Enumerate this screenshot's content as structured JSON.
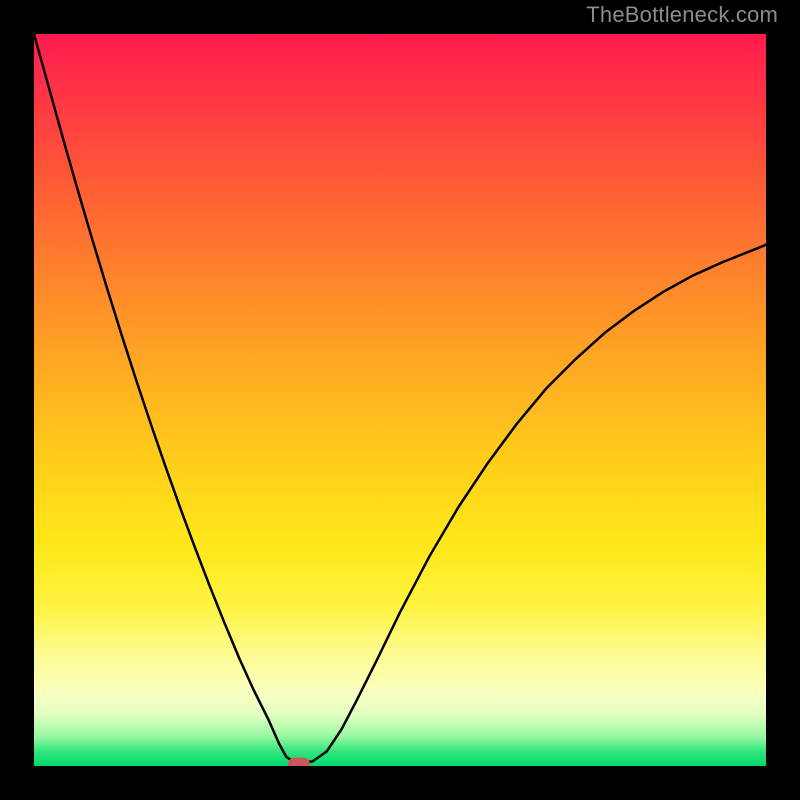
{
  "watermark": "TheBottleneck.com",
  "chart_data": {
    "type": "line",
    "title": "",
    "xlabel": "",
    "ylabel": "",
    "xlim": [
      0,
      1
    ],
    "ylim": [
      0,
      1
    ],
    "series": [
      {
        "name": "bottleneck-curve",
        "x": [
          0.0,
          0.02,
          0.04,
          0.06,
          0.08,
          0.1,
          0.12,
          0.14,
          0.16,
          0.18,
          0.2,
          0.22,
          0.24,
          0.26,
          0.28,
          0.3,
          0.32,
          0.335,
          0.345,
          0.355,
          0.38,
          0.4,
          0.42,
          0.44,
          0.47,
          0.5,
          0.54,
          0.58,
          0.62,
          0.66,
          0.7,
          0.74,
          0.78,
          0.82,
          0.86,
          0.9,
          0.94,
          0.98,
          1.0
        ],
        "y": [
          1.0,
          0.928,
          0.856,
          0.786,
          0.718,
          0.652,
          0.588,
          0.526,
          0.466,
          0.408,
          0.352,
          0.298,
          0.246,
          0.196,
          0.148,
          0.104,
          0.064,
          0.03,
          0.012,
          0.006,
          0.006,
          0.02,
          0.05,
          0.088,
          0.148,
          0.21,
          0.286,
          0.354,
          0.414,
          0.468,
          0.516,
          0.556,
          0.592,
          0.622,
          0.648,
          0.67,
          0.688,
          0.704,
          0.712
        ]
      }
    ],
    "marker": {
      "name": "optimal-point",
      "x": 0.362,
      "y": 0.003,
      "color": "#c95959"
    },
    "gradient_colors": {
      "top": "#ff1a4d",
      "mid": "#ffd21a",
      "bottom": "#00d96b"
    }
  }
}
